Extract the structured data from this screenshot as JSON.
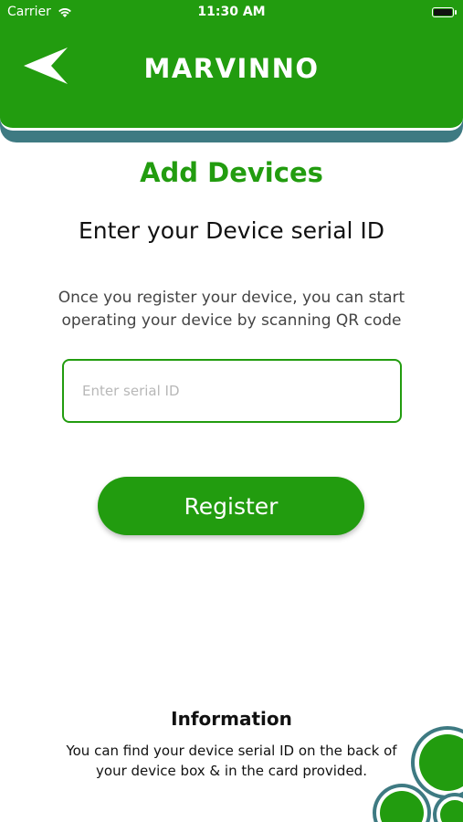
{
  "status_bar": {
    "carrier": "Carrier",
    "time": "11:30 AM",
    "wifi_icon": "wifi-icon",
    "battery_icon": "battery-icon"
  },
  "header": {
    "title": "MARVINNO",
    "back_icon": "back-arrow-icon",
    "background_color": "#229c0f",
    "stripe_color": "#3e7a82"
  },
  "main": {
    "page_title": "Add Devices",
    "subtitle": "Enter your Device serial ID",
    "description": "Once you register your device, you can start operating your device by scanning QR code",
    "serial_input": {
      "value": "",
      "placeholder": "Enter serial ID"
    },
    "register_label": "Register"
  },
  "info": {
    "title": "Information",
    "text": "You can find your device serial ID on the back of your device box & in the card provided."
  },
  "colors": {
    "accent": "#229c0f",
    "teal": "#3e7a82",
    "text": "#111111"
  }
}
